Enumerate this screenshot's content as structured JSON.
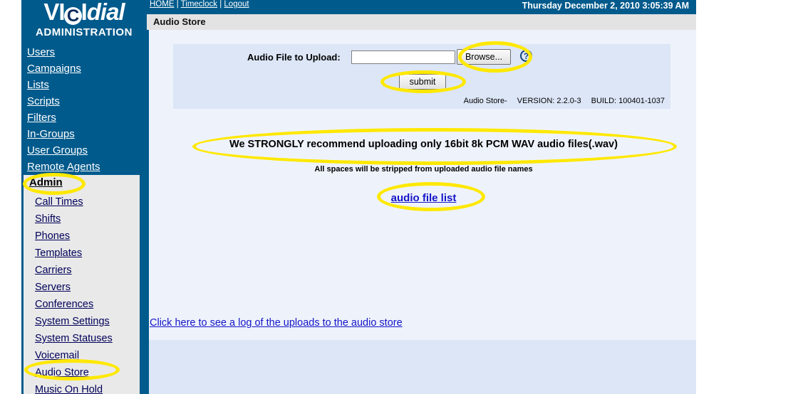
{
  "brand": {
    "logo_part1": "VI",
    "logo_c": "C",
    "logo_part2": "I",
    "logo_italic": "dial",
    "subtitle": "ADMINISTRATION"
  },
  "topbar": {
    "home_label": "HOME",
    "timeclock_label": "Timeclock",
    "logout_label": "Logout",
    "separator": " | ",
    "datetime": "Thursday December 2, 2010 3:05:39 AM"
  },
  "page": {
    "title": "Audio Store"
  },
  "sidebar": {
    "items": [
      {
        "label": "Users"
      },
      {
        "label": "Campaigns"
      },
      {
        "label": "Lists"
      },
      {
        "label": "Scripts"
      },
      {
        "label": "Filters"
      },
      {
        "label": "In-Groups"
      },
      {
        "label": "User Groups"
      },
      {
        "label": "Remote Agents"
      }
    ],
    "admin_label": "Admin",
    "admin_items": [
      {
        "label": "Call Times"
      },
      {
        "label": "Shifts"
      },
      {
        "label": "Phones"
      },
      {
        "label": "Templates"
      },
      {
        "label": "Carriers"
      },
      {
        "label": "Servers"
      },
      {
        "label": "Conferences"
      },
      {
        "label": "System Settings"
      },
      {
        "label": "System Statuses"
      },
      {
        "label": "Voicemail"
      },
      {
        "label": "Audio Store"
      },
      {
        "label": "Music On Hold"
      }
    ]
  },
  "form": {
    "upload_label": "Audio File to Upload:",
    "file_value": "",
    "browse_label": "Browse...",
    "help_icon": "?",
    "submit_label": "submit"
  },
  "version": {
    "app": "Audio Store-",
    "version": "VERSION: 2.2.0-3",
    "build": "BUILD: 100401-1037"
  },
  "notices": {
    "primary": "We STRONGLY recommend uploading only 16bit 8k PCM WAV audio files(.wav)",
    "secondary": "All spaces will be stripped from uploaded audio file names"
  },
  "links": {
    "audio_file_list": "audio file list",
    "upload_log": "Click here to see a log of the uploads to the audio store"
  },
  "colors": {
    "sidebar_blue": "#005a8c",
    "content_bg": "#eef3fb",
    "panel_bg": "#dce6f7",
    "highlight_yellow": "#ffe800",
    "link_blue": "#1414c8"
  }
}
